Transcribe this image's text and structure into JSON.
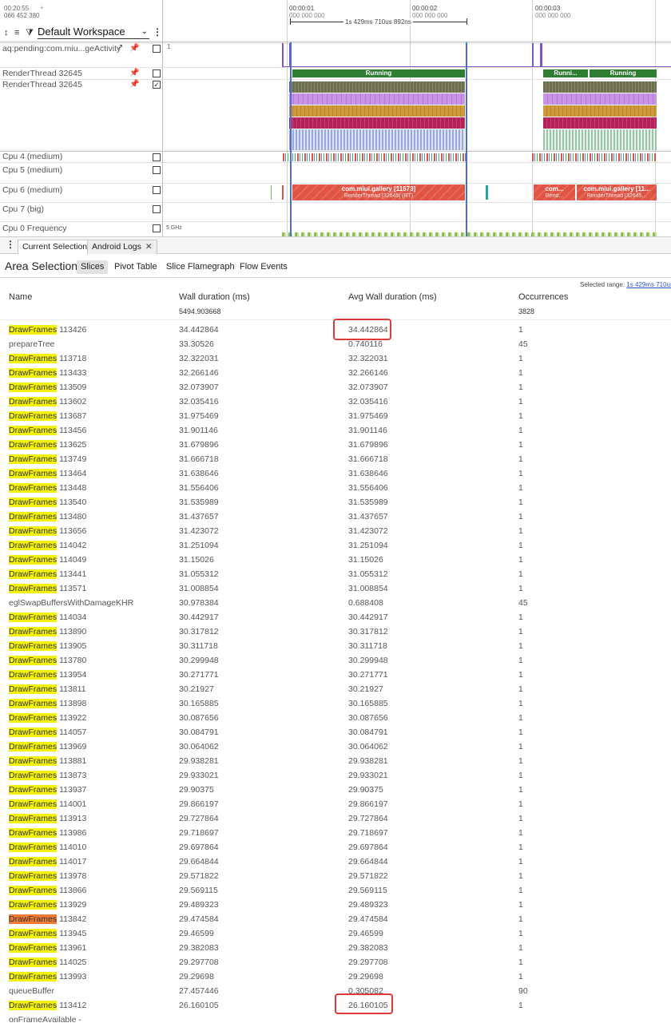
{
  "timeline": {
    "time_top": "00:20:55",
    "time_sub": "066 452 380",
    "plus": "+",
    "ticks": [
      {
        "label": "00:00:01",
        "sub": "000 000 000"
      },
      {
        "label": "00:00:02",
        "sub": "000 000 000"
      },
      {
        "label": "00:00:03",
        "sub": "000 000 000"
      }
    ],
    "span_label": "1s 429ms 710us 892ns"
  },
  "toolbar": {
    "workspace": "Default Workspace"
  },
  "tracks": [
    {
      "name": "aq:pending:com.miu...geActivity",
      "value": "1"
    },
    {
      "name": "RenderThread 32645"
    },
    {
      "name": "RenderThread 32645"
    },
    {
      "name": "Cpu 4 (medium)"
    },
    {
      "name": "Cpu 5 (medium)"
    },
    {
      "name": "Cpu 6 (medium)"
    },
    {
      "name": "Cpu 7 (big)"
    },
    {
      "name": "Cpu 0 Frequency",
      "value": "5 GHz"
    }
  ],
  "slices": {
    "running_1": "Running",
    "running_2a": "Runni...",
    "running_2b": "Running",
    "gallery_1": "com.miui.gallery [11573]",
    "gallery_1_sub": "RenderThread [32645] (RT)",
    "gallery_2a": "com...",
    "gallery_2a_sub": "Rend...",
    "gallery_2b": "com.miui.gallery [11...",
    "gallery_2b_sub": "RenderThread [32645..."
  },
  "tabs": {
    "current": "Current Selection",
    "android_logs": "Android Logs"
  },
  "area": {
    "title": "Area Selection",
    "subtabs": [
      "Slices",
      "Pivot Table",
      "Slice Flamegraph",
      "Flow Events"
    ],
    "selected_range_label": "Selected range:",
    "selected_range_value": "1s 429ms 710us"
  },
  "table": {
    "headers": {
      "name": "Name",
      "wall": "Wall duration (ms)",
      "avg": "Avg Wall duration (ms)",
      "occ": "Occurrences"
    },
    "totals": {
      "wall": "5494.903668",
      "occ": "3828"
    },
    "rows": [
      {
        "name": "DrawFrames",
        "id": "113426",
        "wall": "34.442864",
        "avg": "34.442864",
        "occ": "1",
        "hl": "y"
      },
      {
        "name": "prepareTree",
        "id": "",
        "wall": "33.30526",
        "avg": "0.740116",
        "occ": "45",
        "hl": ""
      },
      {
        "name": "DrawFrames",
        "id": "113718",
        "wall": "32.322031",
        "avg": "32.322031",
        "occ": "1",
        "hl": "y"
      },
      {
        "name": "DrawFrames",
        "id": "113433",
        "wall": "32.266146",
        "avg": "32.266146",
        "occ": "1",
        "hl": "y"
      },
      {
        "name": "DrawFrames",
        "id": "113509",
        "wall": "32.073907",
        "avg": "32.073907",
        "occ": "1",
        "hl": "y"
      },
      {
        "name": "DrawFrames",
        "id": "113602",
        "wall": "32.035416",
        "avg": "32.035416",
        "occ": "1",
        "hl": "y"
      },
      {
        "name": "DrawFrames",
        "id": "113687",
        "wall": "31.975469",
        "avg": "31.975469",
        "occ": "1",
        "hl": "y"
      },
      {
        "name": "DrawFrames",
        "id": "113456",
        "wall": "31.901146",
        "avg": "31.901146",
        "occ": "1",
        "hl": "y"
      },
      {
        "name": "DrawFrames",
        "id": "113625",
        "wall": "31.679896",
        "avg": "31.679896",
        "occ": "1",
        "hl": "y"
      },
      {
        "name": "DrawFrames",
        "id": "113749",
        "wall": "31.666718",
        "avg": "31.666718",
        "occ": "1",
        "hl": "y"
      },
      {
        "name": "DrawFrames",
        "id": "113464",
        "wall": "31.638646",
        "avg": "31.638646",
        "occ": "1",
        "hl": "y"
      },
      {
        "name": "DrawFrames",
        "id": "113448",
        "wall": "31.556406",
        "avg": "31.556406",
        "occ": "1",
        "hl": "y"
      },
      {
        "name": "DrawFrames",
        "id": "113540",
        "wall": "31.535989",
        "avg": "31.535989",
        "occ": "1",
        "hl": "y"
      },
      {
        "name": "DrawFrames",
        "id": "113480",
        "wall": "31.437657",
        "avg": "31.437657",
        "occ": "1",
        "hl": "y"
      },
      {
        "name": "DrawFrames",
        "id": "113656",
        "wall": "31.423072",
        "avg": "31.423072",
        "occ": "1",
        "hl": "y"
      },
      {
        "name": "DrawFrames",
        "id": "114042",
        "wall": "31.251094",
        "avg": "31.251094",
        "occ": "1",
        "hl": "y"
      },
      {
        "name": "DrawFrames",
        "id": "114049",
        "wall": "31.15026",
        "avg": "31.15026",
        "occ": "1",
        "hl": "y"
      },
      {
        "name": "DrawFrames",
        "id": "113441",
        "wall": "31.055312",
        "avg": "31.055312",
        "occ": "1",
        "hl": "y"
      },
      {
        "name": "DrawFrames",
        "id": "113571",
        "wall": "31.008854",
        "avg": "31.008854",
        "occ": "1",
        "hl": "y"
      },
      {
        "name": "eglSwapBuffersWithDamageKHR",
        "id": "",
        "wall": "30.978384",
        "avg": "0.688408",
        "occ": "45",
        "hl": ""
      },
      {
        "name": "DrawFrames",
        "id": "114034",
        "wall": "30.442917",
        "avg": "30.442917",
        "occ": "1",
        "hl": "y"
      },
      {
        "name": "DrawFrames",
        "id": "113890",
        "wall": "30.317812",
        "avg": "30.317812",
        "occ": "1",
        "hl": "y"
      },
      {
        "name": "DrawFrames",
        "id": "113905",
        "wall": "30.311718",
        "avg": "30.311718",
        "occ": "1",
        "hl": "y"
      },
      {
        "name": "DrawFrames",
        "id": "113780",
        "wall": "30.299948",
        "avg": "30.299948",
        "occ": "1",
        "hl": "y"
      },
      {
        "name": "DrawFrames",
        "id": "113954",
        "wall": "30.271771",
        "avg": "30.271771",
        "occ": "1",
        "hl": "y"
      },
      {
        "name": "DrawFrames",
        "id": "113811",
        "wall": "30.21927",
        "avg": "30.21927",
        "occ": "1",
        "hl": "y"
      },
      {
        "name": "DrawFrames",
        "id": "113898",
        "wall": "30.165885",
        "avg": "30.165885",
        "occ": "1",
        "hl": "y"
      },
      {
        "name": "DrawFrames",
        "id": "113922",
        "wall": "30.087656",
        "avg": "30.087656",
        "occ": "1",
        "hl": "y"
      },
      {
        "name": "DrawFrames",
        "id": "114057",
        "wall": "30.084791",
        "avg": "30.084791",
        "occ": "1",
        "hl": "y"
      },
      {
        "name": "DrawFrames",
        "id": "113969",
        "wall": "30.064062",
        "avg": "30.064062",
        "occ": "1",
        "hl": "y"
      },
      {
        "name": "DrawFrames",
        "id": "113881",
        "wall": "29.938281",
        "avg": "29.938281",
        "occ": "1",
        "hl": "y"
      },
      {
        "name": "DrawFrames",
        "id": "113873",
        "wall": "29.933021",
        "avg": "29.933021",
        "occ": "1",
        "hl": "y"
      },
      {
        "name": "DrawFrames",
        "id": "113937",
        "wall": "29.90375",
        "avg": "29.90375",
        "occ": "1",
        "hl": "y"
      },
      {
        "name": "DrawFrames",
        "id": "114001",
        "wall": "29.866197",
        "avg": "29.866197",
        "occ": "1",
        "hl": "y"
      },
      {
        "name": "DrawFrames",
        "id": "113913",
        "wall": "29.727864",
        "avg": "29.727864",
        "occ": "1",
        "hl": "y"
      },
      {
        "name": "DrawFrames",
        "id": "113986",
        "wall": "29.718697",
        "avg": "29.718697",
        "occ": "1",
        "hl": "y"
      },
      {
        "name": "DrawFrames",
        "id": "114010",
        "wall": "29.697864",
        "avg": "29.697864",
        "occ": "1",
        "hl": "y"
      },
      {
        "name": "DrawFrames",
        "id": "114017",
        "wall": "29.664844",
        "avg": "29.664844",
        "occ": "1",
        "hl": "y"
      },
      {
        "name": "DrawFrames",
        "id": "113978",
        "wall": "29.571822",
        "avg": "29.571822",
        "occ": "1",
        "hl": "y"
      },
      {
        "name": "DrawFrames",
        "id": "113866",
        "wall": "29.569115",
        "avg": "29.569115",
        "occ": "1",
        "hl": "y"
      },
      {
        "name": "DrawFrames",
        "id": "113929",
        "wall": "29.489323",
        "avg": "29.489323",
        "occ": "1",
        "hl": "y"
      },
      {
        "name": "DrawFrames",
        "id": "113842",
        "wall": "29.474584",
        "avg": "29.474584",
        "occ": "1",
        "hl": "o"
      },
      {
        "name": "DrawFrames",
        "id": "113945",
        "wall": "29.46599",
        "avg": "29.46599",
        "occ": "1",
        "hl": "y"
      },
      {
        "name": "DrawFrames",
        "id": "113961",
        "wall": "29.382083",
        "avg": "29.382083",
        "occ": "1",
        "hl": "y"
      },
      {
        "name": "DrawFrames",
        "id": "114025",
        "wall": "29.297708",
        "avg": "29.297708",
        "occ": "1",
        "hl": "y"
      },
      {
        "name": "DrawFrames",
        "id": "113993",
        "wall": "29.29698",
        "avg": "29.29698",
        "occ": "1",
        "hl": "y"
      },
      {
        "name": "queueBuffer",
        "id": "",
        "wall": "27.457446",
        "avg": "0.305082",
        "occ": "90",
        "hl": ""
      },
      {
        "name": "DrawFrames",
        "id": "113412",
        "wall": "26.160105",
        "avg": "26.160105",
        "occ": "1",
        "hl": "y"
      },
      {
        "name": "onFrameAvailable -",
        "id": "",
        "wall": "",
        "avg": "",
        "occ": "",
        "hl": ""
      }
    ]
  }
}
